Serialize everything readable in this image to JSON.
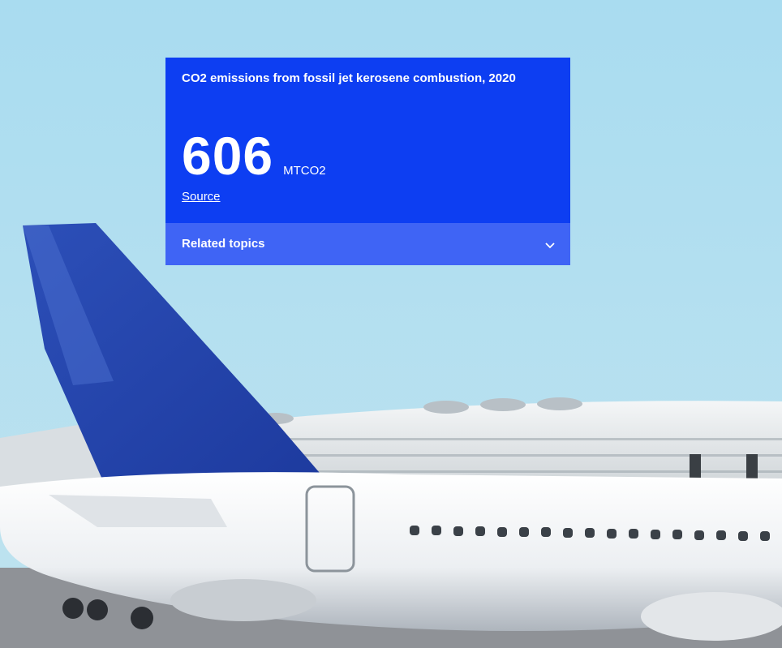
{
  "card": {
    "title": "CO2 emissions from fossil jet kerosene combustion, 2020",
    "value": "606",
    "unit": "MTCO2",
    "source_label": "Source",
    "related_label": "Related topics"
  },
  "colors": {
    "card_bg": "#0d3ef2",
    "topics_bg": "#3f64f5",
    "sky": "#a7dbef"
  },
  "icons": {
    "related_toggle": "chevron-down-icon"
  }
}
